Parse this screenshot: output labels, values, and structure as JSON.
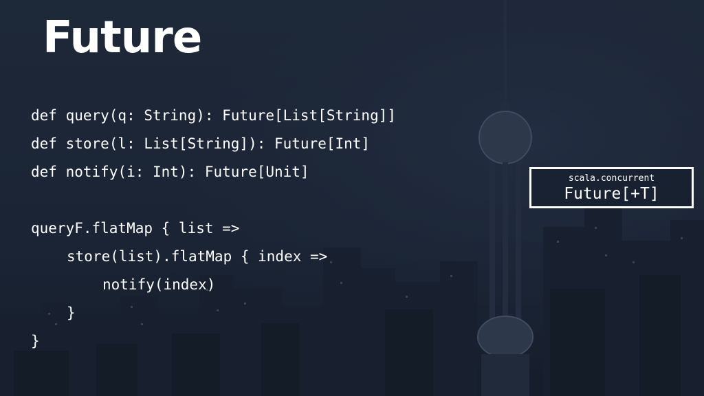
{
  "slide": {
    "title": "Future",
    "code_lines": [
      "def query(q: String): Future[List[String]]",
      "def store(l: List[String]): Future[Int]",
      "def notify(i: Int): Future[Unit]",
      "",
      "queryF.flatMap { list =>",
      "store(list).flatMap { index =>",
      "notify(index)",
      "}",
      "}"
    ],
    "type_box": {
      "package": "scala.concurrent",
      "type": "Future[+T]"
    }
  },
  "colors": {
    "background": "#1f2a3b",
    "text": "#ffffff"
  }
}
